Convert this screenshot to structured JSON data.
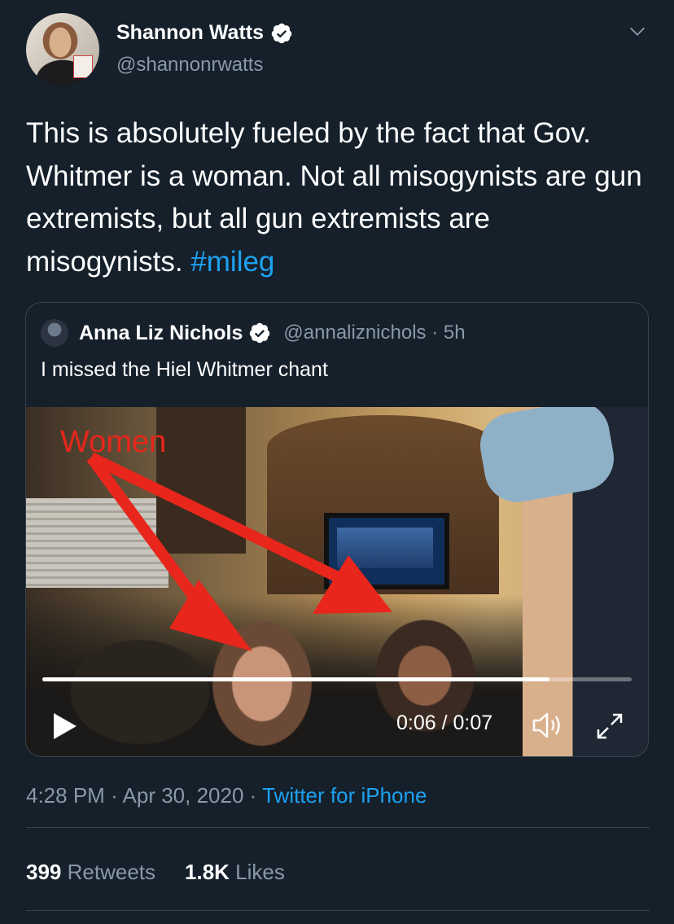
{
  "author": {
    "display_name": "Shannon Watts",
    "handle": "@shannonrwatts",
    "verified": true
  },
  "tweet": {
    "text_main": "This is absolutely fueled by the fact that Gov. Whitmer is a woman. Not all misogynists are gun extremists, but all gun extremists are misogynists.",
    "hashtag": "#mileg"
  },
  "quoted_tweet": {
    "display_name": "Anna Liz Nichols",
    "handle_time": "@annaliznichols · 5h",
    "verified": true,
    "text": "I missed the Hiel Whitmer chant",
    "video": {
      "overlay_label": "Women",
      "time": "0:06 / 0:07",
      "progress": 0.86
    }
  },
  "meta": {
    "time": "4:28 PM",
    "separator": "·",
    "date": "Apr 30, 2020",
    "source": "Twitter for iPhone"
  },
  "stats": {
    "retweets_count": "399",
    "retweets_label": "Retweets",
    "likes_count": "1.8K",
    "likes_label": "Likes"
  },
  "colors": {
    "background": "#15202b",
    "accent": "#1da1f2",
    "secondary_text": "#8899a6",
    "annotation_red": "#e8261b"
  },
  "icons": [
    "verified-badge-icon",
    "chevron-down-icon",
    "play-icon",
    "volume-icon",
    "fullscreen-icon"
  ]
}
